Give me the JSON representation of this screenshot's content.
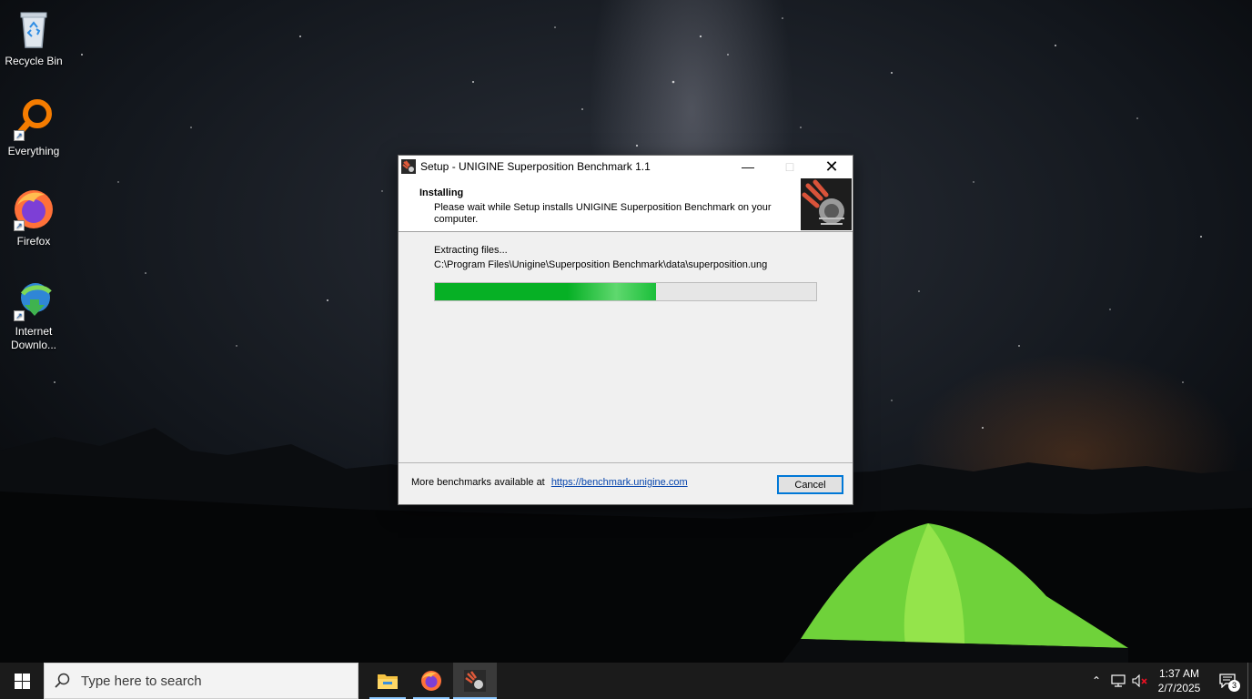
{
  "desktop": {
    "icons": [
      {
        "label": "Recycle Bin",
        "icon": "recycle-bin-icon"
      },
      {
        "label": "Everything",
        "icon": "everything-search-icon"
      },
      {
        "label": "Firefox",
        "icon": "firefox-icon"
      },
      {
        "label": "Internet Downlo...",
        "label_line1": "Internet",
        "label_line2": "Downlo...",
        "icon": "internet-download-manager-icon"
      }
    ]
  },
  "dialog": {
    "title": "Setup - UNIGINE Superposition Benchmark 1.1",
    "header_title": "Installing",
    "header_desc": "Please wait while Setup installs UNIGINE Superposition Benchmark on your computer.",
    "status": "Extracting files...",
    "filename": "C:\\Program Files\\Unigine\\Superposition Benchmark\\data\\superposition.ung",
    "progress_percent": 58,
    "footer_text": "More benchmarks available at",
    "footer_link": "https://benchmark.unigine.com",
    "cancel_label": "Cancel"
  },
  "taskbar": {
    "search_placeholder": "Type here to search",
    "apps": [
      "file-explorer-icon",
      "firefox-icon",
      "superposition-setup-icon"
    ],
    "active_app": "superposition-setup-icon",
    "time": "1:37 AM",
    "date": "2/7/2025",
    "notification_count": "3"
  },
  "colors": {
    "progress_green": "#06b025",
    "link_blue": "#0645ad",
    "focus_blue": "#0078d7",
    "taskbar_bg": "#1b1b1b"
  }
}
